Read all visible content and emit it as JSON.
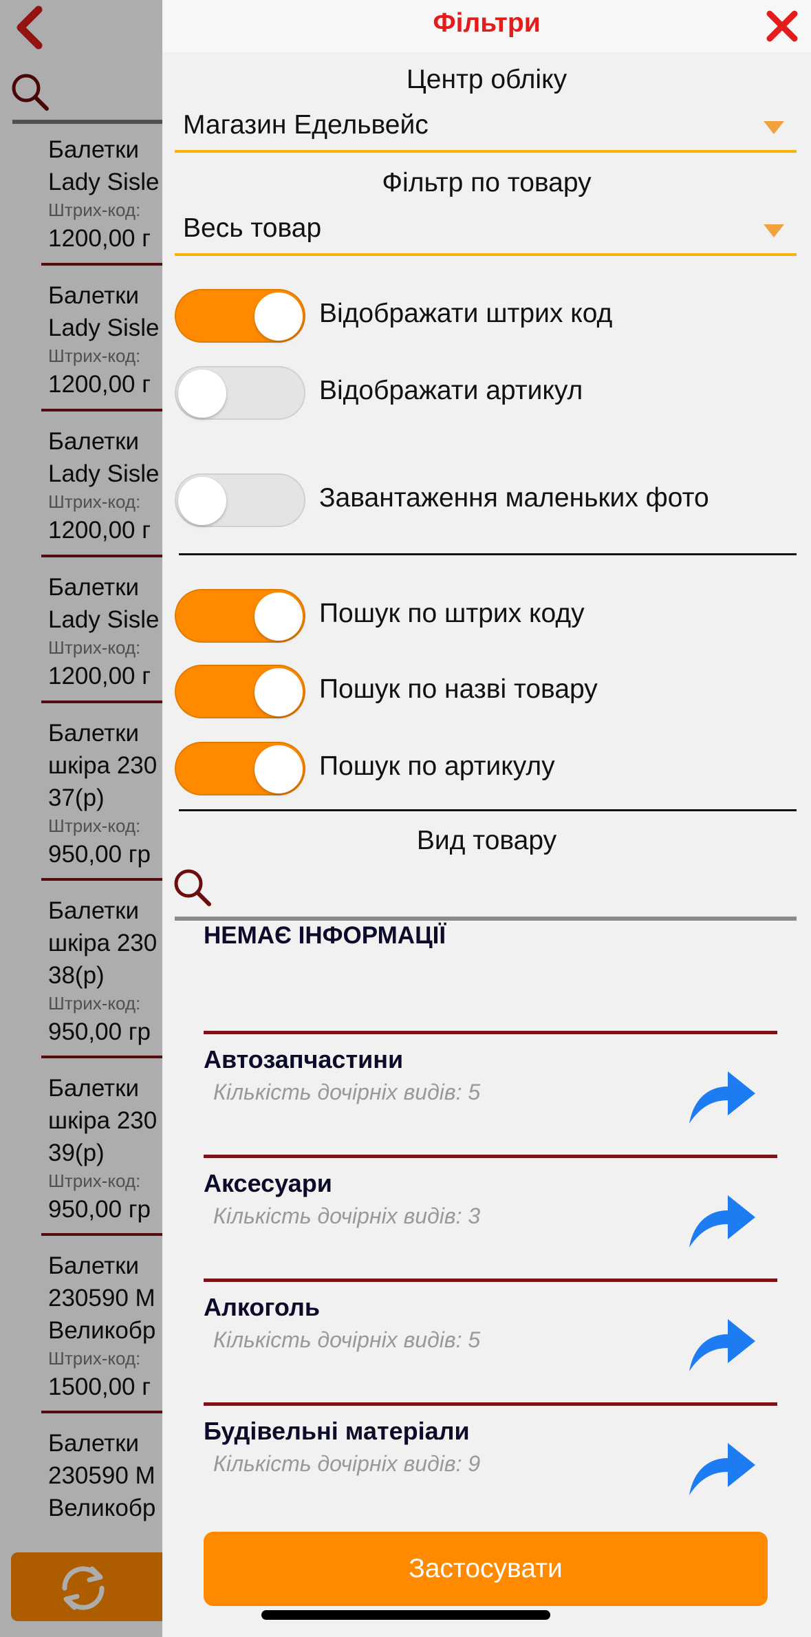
{
  "background": {
    "items": [
      {
        "line1": "Балетки",
        "line2": "Lady Sisle",
        "line3": "",
        "code": "Штрих-код:",
        "price": "1200,00 г"
      },
      {
        "line1": "Балетки",
        "line2": "Lady Sisle",
        "line3": "",
        "code": "Штрих-код:",
        "price": "1200,00 г"
      },
      {
        "line1": "Балетки",
        "line2": "Lady Sisle",
        "line3": "",
        "code": "Штрих-код:",
        "price": "1200,00 г"
      },
      {
        "line1": "Балетки",
        "line2": "Lady Sisle",
        "line3": "",
        "code": "Штрих-код:",
        "price": "1200,00 г"
      },
      {
        "line1": "Балетки",
        "line2": "шкіра 230",
        "line3": "37(р)",
        "code": "Штрих-код:",
        "price": "950,00 гр"
      },
      {
        "line1": "Балетки",
        "line2": "шкіра 230",
        "line3": "38(р)",
        "code": "Штрих-код:",
        "price": "950,00 гр"
      },
      {
        "line1": "Балетки",
        "line2": "шкіра 230",
        "line3": "39(р)",
        "code": "Штрих-код:",
        "price": "950,00 гр"
      },
      {
        "line1": "Балетки",
        "line2": "230590 М",
        "line3": "Великобр",
        "code": "Штрих-код:",
        "price": "1500,00 г"
      },
      {
        "line1": "Балетки",
        "line2": "230590 М",
        "line3": "Великобр",
        "code": "",
        "price": ""
      }
    ]
  },
  "filters": {
    "title": "Фільтри",
    "center_label": "Центр обліку",
    "center_value": "Магазин Едельвейс",
    "product_filter_label": "Фільтр по товару",
    "product_filter_value": "Весь товар",
    "toggles": [
      {
        "label": "Відображати штрих код",
        "on": true
      },
      {
        "label": "Відображати артикул",
        "on": false
      },
      {
        "label": "Завантаження маленьких фото",
        "on": false
      },
      {
        "label": "Пошук по штрих коду",
        "on": true
      },
      {
        "label": "Пошук по назві товару",
        "on": true
      },
      {
        "label": "Пошук по артикулу",
        "on": true
      }
    ],
    "product_type_label": "Вид товару",
    "no_info": "НЕМАЄ ІНФОРМАЦІЇ",
    "categories": [
      {
        "name": "Автозапчастини",
        "count": "Кількість дочірніх видів: 5"
      },
      {
        "name": "Аксесуари",
        "count": "Кількість дочірніх видів: 3"
      },
      {
        "name": "Алкоголь",
        "count": "Кількість дочірніх видів: 5"
      },
      {
        "name": "Будівельні матеріали",
        "count": "Кількість дочірніх видів: 9"
      }
    ],
    "apply_label": "Застосувати"
  },
  "colors": {
    "accent": "#ff8a00",
    "title_red": "#e41c1c",
    "divider": "#7a1416",
    "arrow_blue": "#1e7cf2"
  }
}
